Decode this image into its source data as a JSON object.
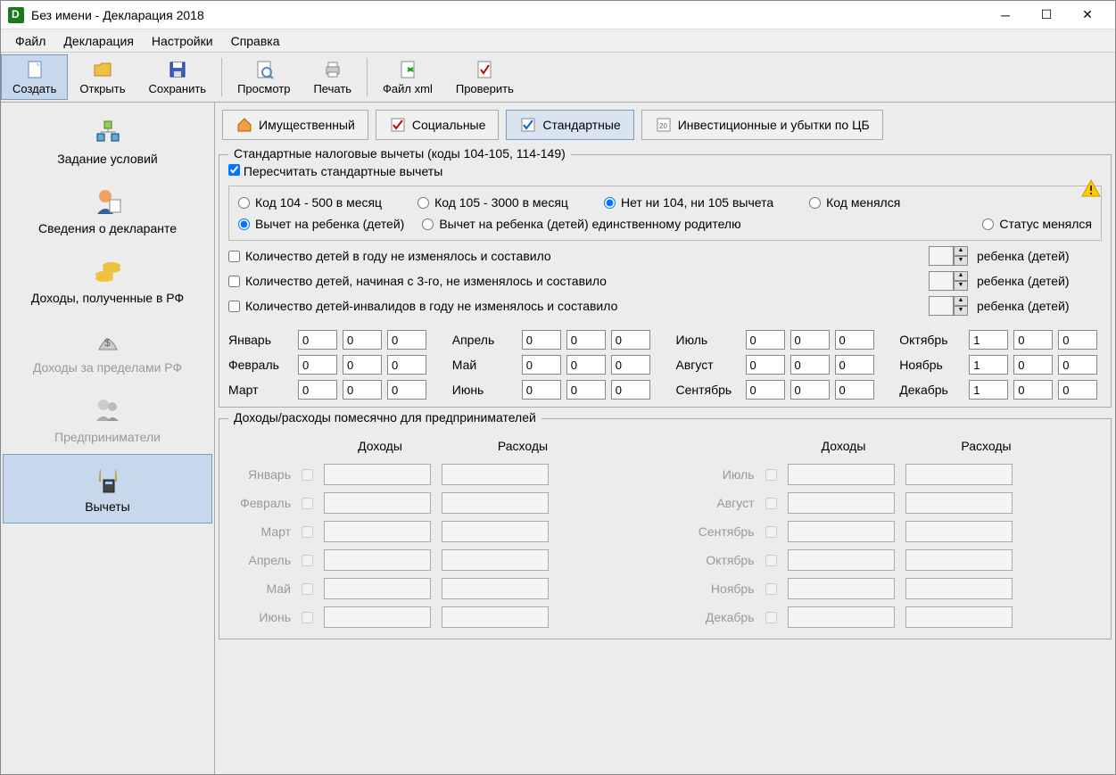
{
  "title": "Без имени - Декларация 2018",
  "menu": [
    "Файл",
    "Декларация",
    "Настройки",
    "Справка"
  ],
  "toolbar": [
    {
      "id": "create",
      "label": "Создать",
      "active": true
    },
    {
      "id": "open",
      "label": "Открыть"
    },
    {
      "id": "save",
      "label": "Сохранить"
    },
    {
      "sep": true
    },
    {
      "id": "preview",
      "label": "Просмотр"
    },
    {
      "id": "print",
      "label": "Печать"
    },
    {
      "sep": true
    },
    {
      "id": "xml",
      "label": "Файл xml"
    },
    {
      "id": "check",
      "label": "Проверить"
    }
  ],
  "sidebar": [
    {
      "id": "conditions",
      "label": "Задание условий"
    },
    {
      "id": "declarant",
      "label": "Сведения о декларанте"
    },
    {
      "id": "income_rf",
      "label": "Доходы, полученные в РФ"
    },
    {
      "id": "income_abroad",
      "label": "Доходы за пределами РФ",
      "disabled": true
    },
    {
      "id": "entrepreneurs",
      "label": "Предприниматели",
      "disabled": true
    },
    {
      "id": "deductions",
      "label": "Вычеты",
      "active": true
    }
  ],
  "tabs": [
    {
      "id": "property",
      "label": "Имущественный"
    },
    {
      "id": "social",
      "label": "Социальные"
    },
    {
      "id": "standard",
      "label": "Стандартные",
      "active": true
    },
    {
      "id": "invest",
      "label": "Инвестиционные и убытки по ЦБ"
    }
  ],
  "group1_title": "Стандартные налоговые вычеты (коды 104-105, 114-149)",
  "recalc_label": "Пересчитать стандартные вычеты",
  "recalc_checked": true,
  "codes": {
    "c104": "Код 104 - 500 в месяц",
    "c105": "Код 105 - 3000 в месяц",
    "none": "Нет ни 104, ни 105 вычета",
    "changed": "Код менялся",
    "selected": "none"
  },
  "child_radio": {
    "child": "Вычет на ребенка (детей)",
    "single_parent": "Вычет на ребенка (детей) единственному родителю",
    "status_changed": "Статус менялся",
    "selected": "child"
  },
  "child_counts": {
    "r1": "Количество детей в году не изменялось и составило",
    "r2": "Количество детей, начиная с 3-го, не изменялось и составило",
    "r3": "Количество детей-инвалидов в году не изменялось и составило",
    "suffix": "ребенка (детей)"
  },
  "months_labels": [
    "Январь",
    "Февраль",
    "Март",
    "Апрель",
    "Май",
    "Июнь",
    "Июль",
    "Август",
    "Сентябрь",
    "Октябрь",
    "Ноябрь",
    "Декабрь"
  ],
  "months_values": [
    [
      "0",
      "0",
      "0"
    ],
    [
      "0",
      "0",
      "0"
    ],
    [
      "0",
      "0",
      "0"
    ],
    [
      "0",
      "0",
      "0"
    ],
    [
      "0",
      "0",
      "0"
    ],
    [
      "0",
      "0",
      "0"
    ],
    [
      "0",
      "0",
      "0"
    ],
    [
      "0",
      "0",
      "0"
    ],
    [
      "0",
      "0",
      "0"
    ],
    [
      "1",
      "0",
      "0"
    ],
    [
      "1",
      "0",
      "0"
    ],
    [
      "1",
      "0",
      "0"
    ]
  ],
  "biz_title": "Доходы/расходы помесячно для предпринимателей",
  "biz_headers": {
    "income": "Доходы",
    "expense": "Расходы"
  },
  "biz_months_left": [
    "Январь",
    "Февраль",
    "Март",
    "Апрель",
    "Май",
    "Июнь"
  ],
  "biz_months_right": [
    "Июль",
    "Август",
    "Сентябрь",
    "Октябрь",
    "Ноябрь",
    "Декабрь"
  ]
}
